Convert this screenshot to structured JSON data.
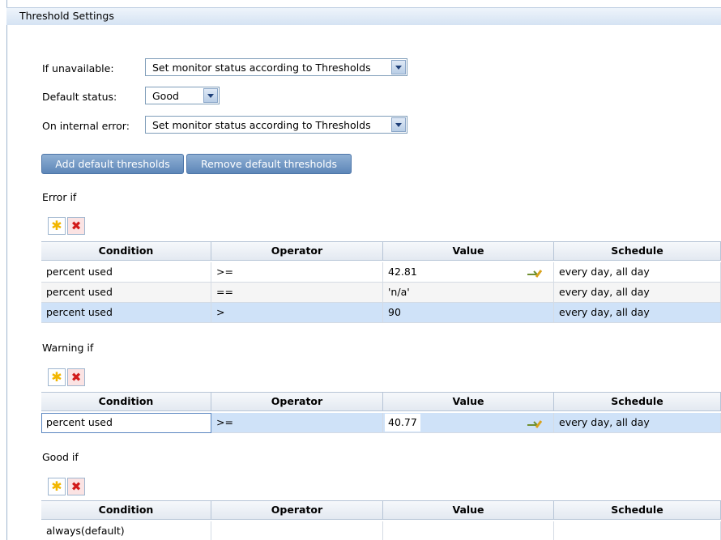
{
  "header": {
    "title": "Threshold Settings"
  },
  "settings": {
    "unavailable_label": "If unavailable:",
    "unavailable_value": "Set monitor status according to Thresholds",
    "default_status_label": "Default status:",
    "default_status_value": "Good",
    "internal_error_label": "On internal error:",
    "internal_error_value": "Set monitor status according to Thresholds"
  },
  "buttons": {
    "add_default": "Add default thresholds",
    "remove_default": "Remove default thresholds"
  },
  "icons": {
    "new": "✱",
    "delete": "✖"
  },
  "columns": [
    "Condition",
    "Operator",
    "Value",
    "Schedule"
  ],
  "error": {
    "label": "Error if",
    "rows": [
      {
        "condition": "percent used",
        "operator": ">=",
        "value": "42.81",
        "schedule": "every day, all day"
      },
      {
        "condition": "percent used",
        "operator": "==",
        "value": "'n/a'",
        "schedule": "every day, all day"
      },
      {
        "condition": "percent used",
        "operator": ">",
        "value": "90",
        "schedule": "every day, all day"
      }
    ]
  },
  "warning": {
    "label": "Warning if",
    "rows": [
      {
        "condition": "percent used",
        "operator": ">=",
        "value": "40.77",
        "schedule": "every day, all day"
      }
    ]
  },
  "good": {
    "label": "Good if",
    "rows": [
      {
        "condition": "always(default)",
        "operator": "",
        "value": "",
        "schedule": ""
      }
    ]
  },
  "colors": {
    "selected_row": "#cfe2f8",
    "button": "#6b90bf"
  }
}
